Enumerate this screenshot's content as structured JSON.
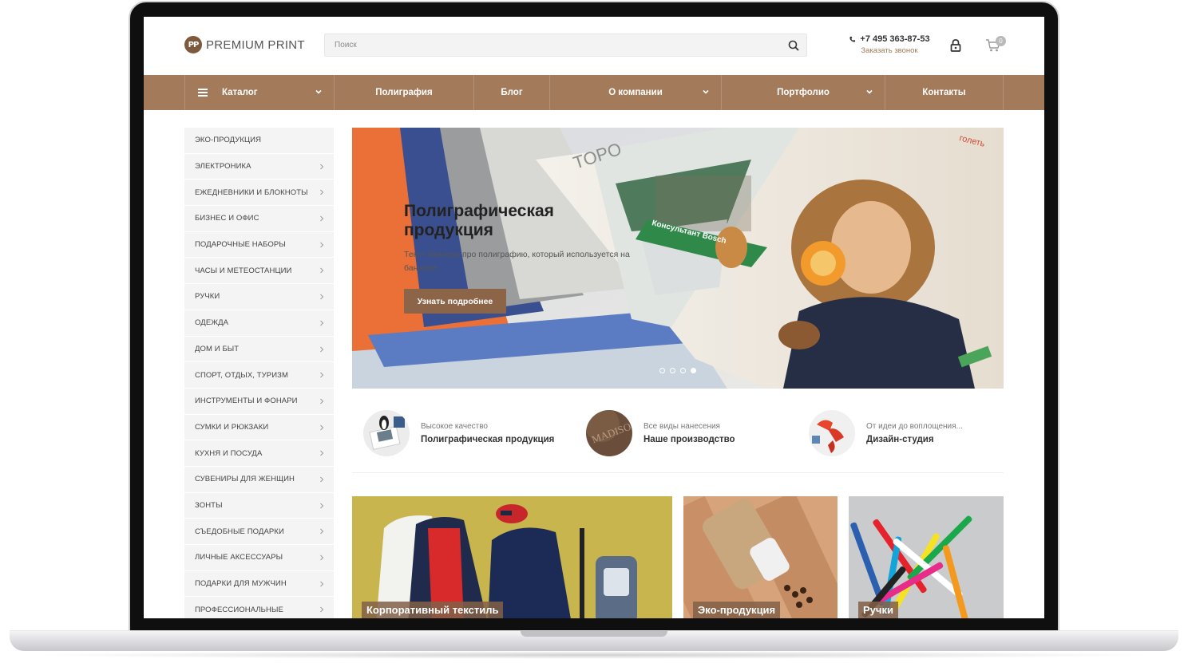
{
  "header": {
    "logo_mark": "PP",
    "logo_text": "PREMIUM PRINT",
    "search_placeholder": "Поиск",
    "phone": "+7 495 363-87-53",
    "callback": "Заказать звонок",
    "cart_count": "0"
  },
  "nav": {
    "items": [
      {
        "label": "Каталог"
      },
      {
        "label": "Полиграфия"
      },
      {
        "label": "Блог"
      },
      {
        "label": "О компании"
      },
      {
        "label": "Портфолио"
      },
      {
        "label": "Контакты"
      }
    ]
  },
  "sidebar": {
    "items": [
      {
        "label": "ЭКО-ПРОДУКЦИЯ"
      },
      {
        "label": "ЭЛЕКТРОНИКА"
      },
      {
        "label": "ЕЖЕДНЕВНИКИ И БЛОКНОТЫ"
      },
      {
        "label": "БИЗНЕС И ОФИС"
      },
      {
        "label": "ПОДАРОЧНЫЕ НАБОРЫ"
      },
      {
        "label": "ЧАСЫ И МЕТЕОСТАНЦИИ"
      },
      {
        "label": "РУЧКИ"
      },
      {
        "label": "ОДЕЖДА"
      },
      {
        "label": "ДОМ И БЫТ"
      },
      {
        "label": "СПОРТ, ОТДЫХ, ТУРИЗМ"
      },
      {
        "label": "ИНСТРУМЕНТЫ И ФОНАРИ"
      },
      {
        "label": "СУМКИ И РЮКЗАКИ"
      },
      {
        "label": "КУХНЯ И ПОСУДА"
      },
      {
        "label": "СУВЕНИРЫ ДЛЯ ЖЕНЩИН"
      },
      {
        "label": "ЗОНТЫ"
      },
      {
        "label": "СЪЕДОБНЫЕ ПОДАРКИ"
      },
      {
        "label": "ЛИЧНЫЕ АКСЕССУАРЫ"
      },
      {
        "label": "ПОДАРКИ ДЛЯ МУЖЧИН"
      },
      {
        "label": "ПРОФЕССИОНАЛЬНЫЕ"
      }
    ]
  },
  "banner": {
    "title": "Полиграфическая продукция",
    "text": "Текст баннера про полиграфию, который используется на баннере",
    "button": "Узнать подробнее",
    "brochure_word": "TOPO",
    "consultant_text": "Консультант Bosch",
    "corner_text": "голеть",
    "slides": 4,
    "active_slide": 4
  },
  "features": [
    {
      "sub": "Высокое качество",
      "title": "Полиграфическая продукция"
    },
    {
      "sub": "Все виды нанесения",
      "title": "Наше производство"
    },
    {
      "sub": "От идеи до воплощения...",
      "title": "Дизайн-студия"
    }
  ],
  "tiles": [
    {
      "label": "Корпоративный текстиль"
    },
    {
      "label": "Эко-продукция"
    },
    {
      "label": "Ручки"
    }
  ],
  "colors": {
    "brand": "#a37a5a",
    "button": "#8c6549",
    "callback": "#a07a57"
  }
}
